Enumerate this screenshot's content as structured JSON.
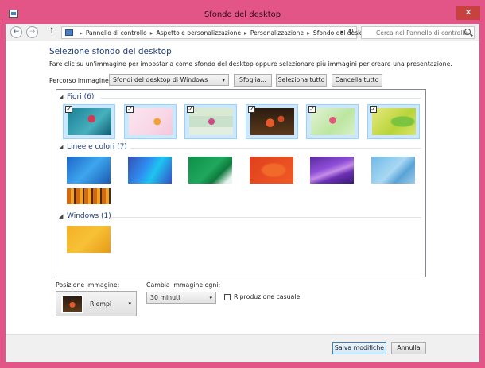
{
  "window": {
    "title": "Sfondo del desktop",
    "close_glyph": "✕"
  },
  "nav": {
    "back_glyph": "←",
    "forward_glyph": "→",
    "up_glyph": "↑",
    "breadcrumbs": [
      "Pannello di controllo",
      "Aspetto e personalizzazione",
      "Personalizzazione",
      "Sfondo del desktop"
    ],
    "separator": "▸",
    "dropdown_glyph": "▾",
    "refresh_glyph": "↻",
    "search_placeholder": "Cerca nel Pannello di controllo"
  },
  "main": {
    "heading": "Selezione sfondo del desktop",
    "description": "Fare clic su un'immagine per impostarla come sfondo del desktop oppure selezionare più immagini per creare una presentazione.",
    "location_label": "Percorso immagine:",
    "location_value": "Sfondi del desktop di Windows",
    "browse_label": "Sfoglia...",
    "select_all_label": "Seleziona tutto",
    "clear_all_label": "Cancella tutto"
  },
  "gallery": {
    "groups": [
      {
        "label": "Fiori (6)",
        "selected": true,
        "items": [
          "flower-teal",
          "flower-pink",
          "flower-green-pale",
          "flower-orange-dark",
          "flower-pink-green",
          "flower-yellow-green"
        ]
      },
      {
        "label": "Linee e colori (7)",
        "selected": false,
        "items": [
          "lines-blue",
          "lines-blue-cyan",
          "lines-green",
          "lines-orange",
          "lines-purple",
          "lines-light-blue",
          "lines-orange-stripes"
        ]
      },
      {
        "label": "Windows (1)",
        "selected": false,
        "items": [
          "windows-yellow"
        ]
      }
    ],
    "check_glyph": "✓",
    "collapse_glyph": "◢"
  },
  "position": {
    "label": "Posizione immagine:",
    "value": "Riempi",
    "arrow": "▾"
  },
  "change": {
    "label": "Cambia immagine ogni:",
    "value": "30 minuti",
    "arrow": "▾",
    "shuffle_label": "Riproduzione casuale"
  },
  "footer": {
    "save_label": "Salva modifiche",
    "cancel_label": "Annulla"
  },
  "colors": {
    "frame": "#e35586",
    "heading": "#1f3d7a",
    "selection": "#cce8ff"
  }
}
